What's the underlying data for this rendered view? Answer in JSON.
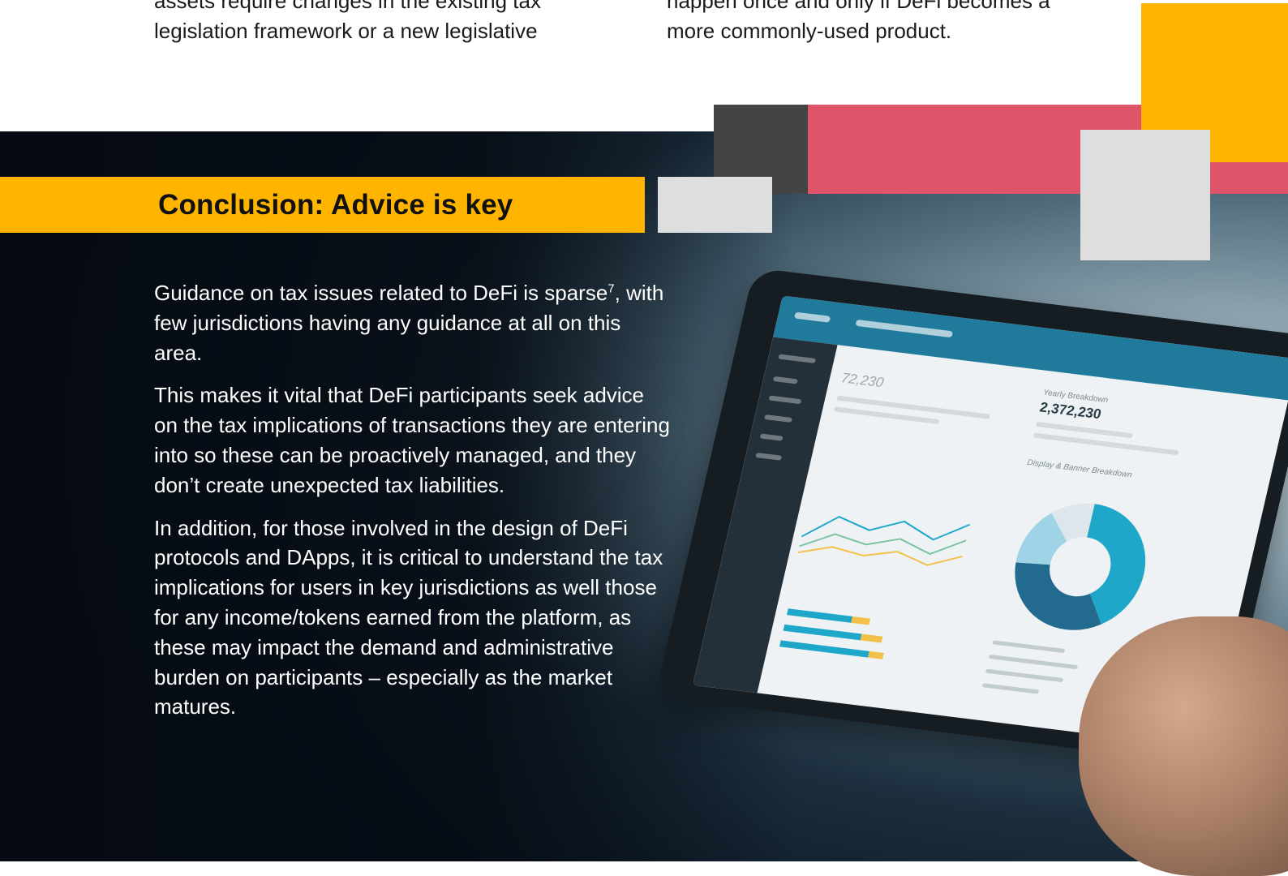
{
  "top_text": {
    "left_lines": [
      "assets require changes in the existing tax",
      "legislation framework or a new legislative"
    ],
    "right_lines": [
      "happen once and only if DeFi becomes a",
      "more commonly-used product."
    ]
  },
  "conclusion": {
    "heading": "Conclusion: Advice is key",
    "paragraph1_main": "Guidance on tax issues related to DeFi is sparse",
    "paragraph1_sup": "7",
    "paragraph1_rest": ", with few jurisdictions having any guidance at all on this area.",
    "paragraph2": "This makes it vital that DeFi participants seek advice on the tax implications of transactions they are entering into so these can be proactively managed, and they don’t create unexpected tax liabilities.",
    "paragraph3": "In addition, for those involved in the design of DeFi protocols and DApps, it is critical to understand the tax implications for users in key jurisdictions as well those for any income/tokens earned from the platform, as these may impact the demand and administrative burden on participants – especially as the market matures."
  },
  "tablet_screen": {
    "stat_left": "72,230",
    "stat_right_label": "Yearly Breakdown",
    "stat_right": "2,372,230",
    "donut_label": "Display & Banner Breakdown"
  },
  "colors": {
    "accent_yellow": "#ffb400",
    "accent_pink": "#de556a",
    "dark_gray": "#444444",
    "light_gray": "#dedede"
  }
}
